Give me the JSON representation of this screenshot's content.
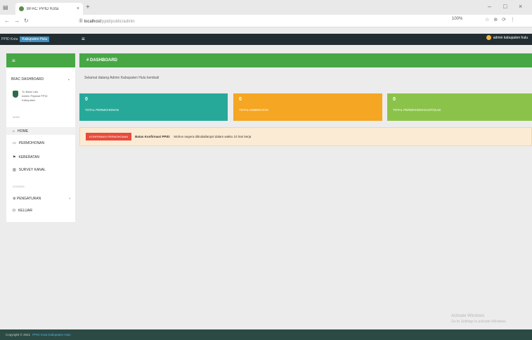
{
  "browser": {
    "tab_title": "BFAC PPID Kota",
    "new_tab": "+",
    "url_host": "localhost",
    "url_path": "/ppid/public/admin",
    "zoom": "100%"
  },
  "header": {
    "brand_prefix": "PPID Kota",
    "brand_highlight": "Kabupaten Hulu",
    "user_name": "admin kabupaten hulu"
  },
  "sidebar": {
    "title": "≡",
    "profile_label": "BFAC DASHBOARD",
    "profile_lines": [
      "Tu Balai Lalu",
      "Admin Pejabat PPID",
      "Kabupaten"
    ],
    "section_main": "MAIN",
    "items": [
      {
        "label": "HOME",
        "icon": "home"
      },
      {
        "label": "PERMOHONAN",
        "icon": "inbox"
      },
      {
        "label": "KEBERATAN",
        "icon": "flag"
      },
      {
        "label": "SURVEY KANAL",
        "icon": "chart"
      }
    ],
    "section_other": "OTHERS",
    "items2": [
      {
        "label": "PENGATURAN",
        "icon": "gear"
      },
      {
        "label": "KELUAR",
        "icon": "power"
      }
    ]
  },
  "main": {
    "title": "# DASHBOARD",
    "welcome": "Selamat datang Admin Kabupaten Hulu kembali",
    "boxes": [
      {
        "number": "0",
        "label": "TOTAL PERMOHONAN",
        "color": "#27a99a"
      },
      {
        "number": "0",
        "label": "TOTAL KEBERATAN",
        "color": "#f5a623"
      },
      {
        "number": "0",
        "label": "TOTAL PERMOHONAN DITOLAK",
        "color": "#8bc34a"
      }
    ],
    "alert_button": "KONFIRMASI PERMOHONAN",
    "alert_bold": "Batas Konfirmasi PPID:",
    "alert_text": "Mohon segera ditindaklanjuti dalam waktu 10 hari kerja"
  },
  "watermark": [
    "Activate Windows",
    "Go to Settings to activate Windows."
  ],
  "footer": {
    "text": "Copyright © 2021",
    "link": "PPID Kota Kabupaten Hulu"
  }
}
